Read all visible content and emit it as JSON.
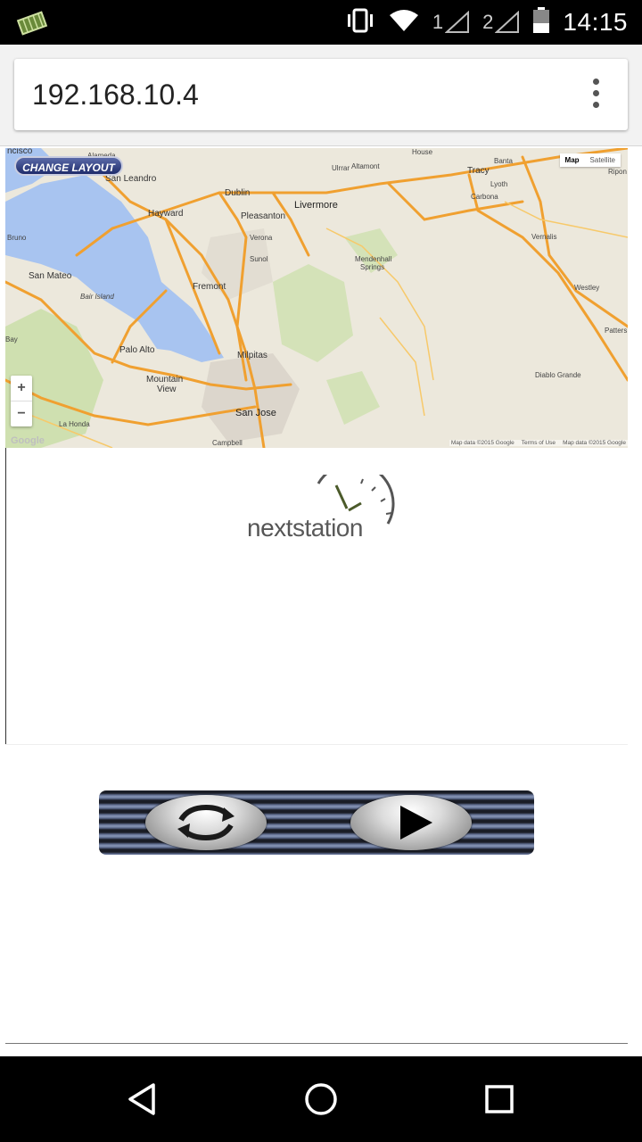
{
  "status_bar": {
    "time": "14:15",
    "sim1_label": "1",
    "sim2_label": "2",
    "icons": [
      "app-notification-icon",
      "vibrate-icon",
      "wifi-icon",
      "signal-icon",
      "signal-icon",
      "battery-icon"
    ]
  },
  "browser": {
    "url": "192.168.10.4",
    "menu_icon": "overflow-menu-icon"
  },
  "map": {
    "change_layout_label": "CHANGE LAYOUT",
    "map_type_options": [
      "Map",
      "Satellite"
    ],
    "map_type_selected": "Map",
    "zoom_in_label": "+",
    "zoom_out_label": "−",
    "google_logo": "Google",
    "attribution": [
      "Map data ©2015 Google",
      "Terms of Use",
      "Map data ©2015 Google"
    ],
    "places": {
      "sf": "ncisco",
      "alameda": "Alameda",
      "san_leandro": "San Leandro",
      "hayward": "Hayward",
      "dublin": "Dublin",
      "pleasanton": "Pleasanton",
      "livermore": "Livermore",
      "altamont": "Altamont",
      "tracy": "Tracy",
      "banta": "Banta",
      "lyoth": "Lyoth",
      "carbona": "Carbona",
      "vernalis": "Vernalis",
      "ripon": "Ripon",
      "house": "House",
      "ulrrar": "Ulrrar",
      "verona": "Verona",
      "sunol": "Sunol",
      "mendenhall": "Mendenhall",
      "springs": "Springs",
      "bruno": "Bruno",
      "san_mateo": "San Mateo",
      "bair_island": "Bair Island",
      "fremont": "Fremont",
      "westley": "Westley",
      "patterson": "Patters",
      "bay": "Bay",
      "palo_alto": "Palo Alto",
      "milpitas": "Milpitas",
      "diablo_grande": "Diablo Grande",
      "mountain_view": "Mountain",
      "view": "View",
      "san_jose": "San Jose",
      "la_honda": "La Honda",
      "campbell": "Campbell"
    }
  },
  "logo": {
    "text_left": "next",
    "text_right": "station"
  },
  "controls": {
    "refresh_icon": "refresh-icon",
    "play_icon": "play-icon"
  },
  "nav": {
    "back_icon": "back-icon",
    "home_icon": "home-icon",
    "recents_icon": "recents-icon"
  }
}
